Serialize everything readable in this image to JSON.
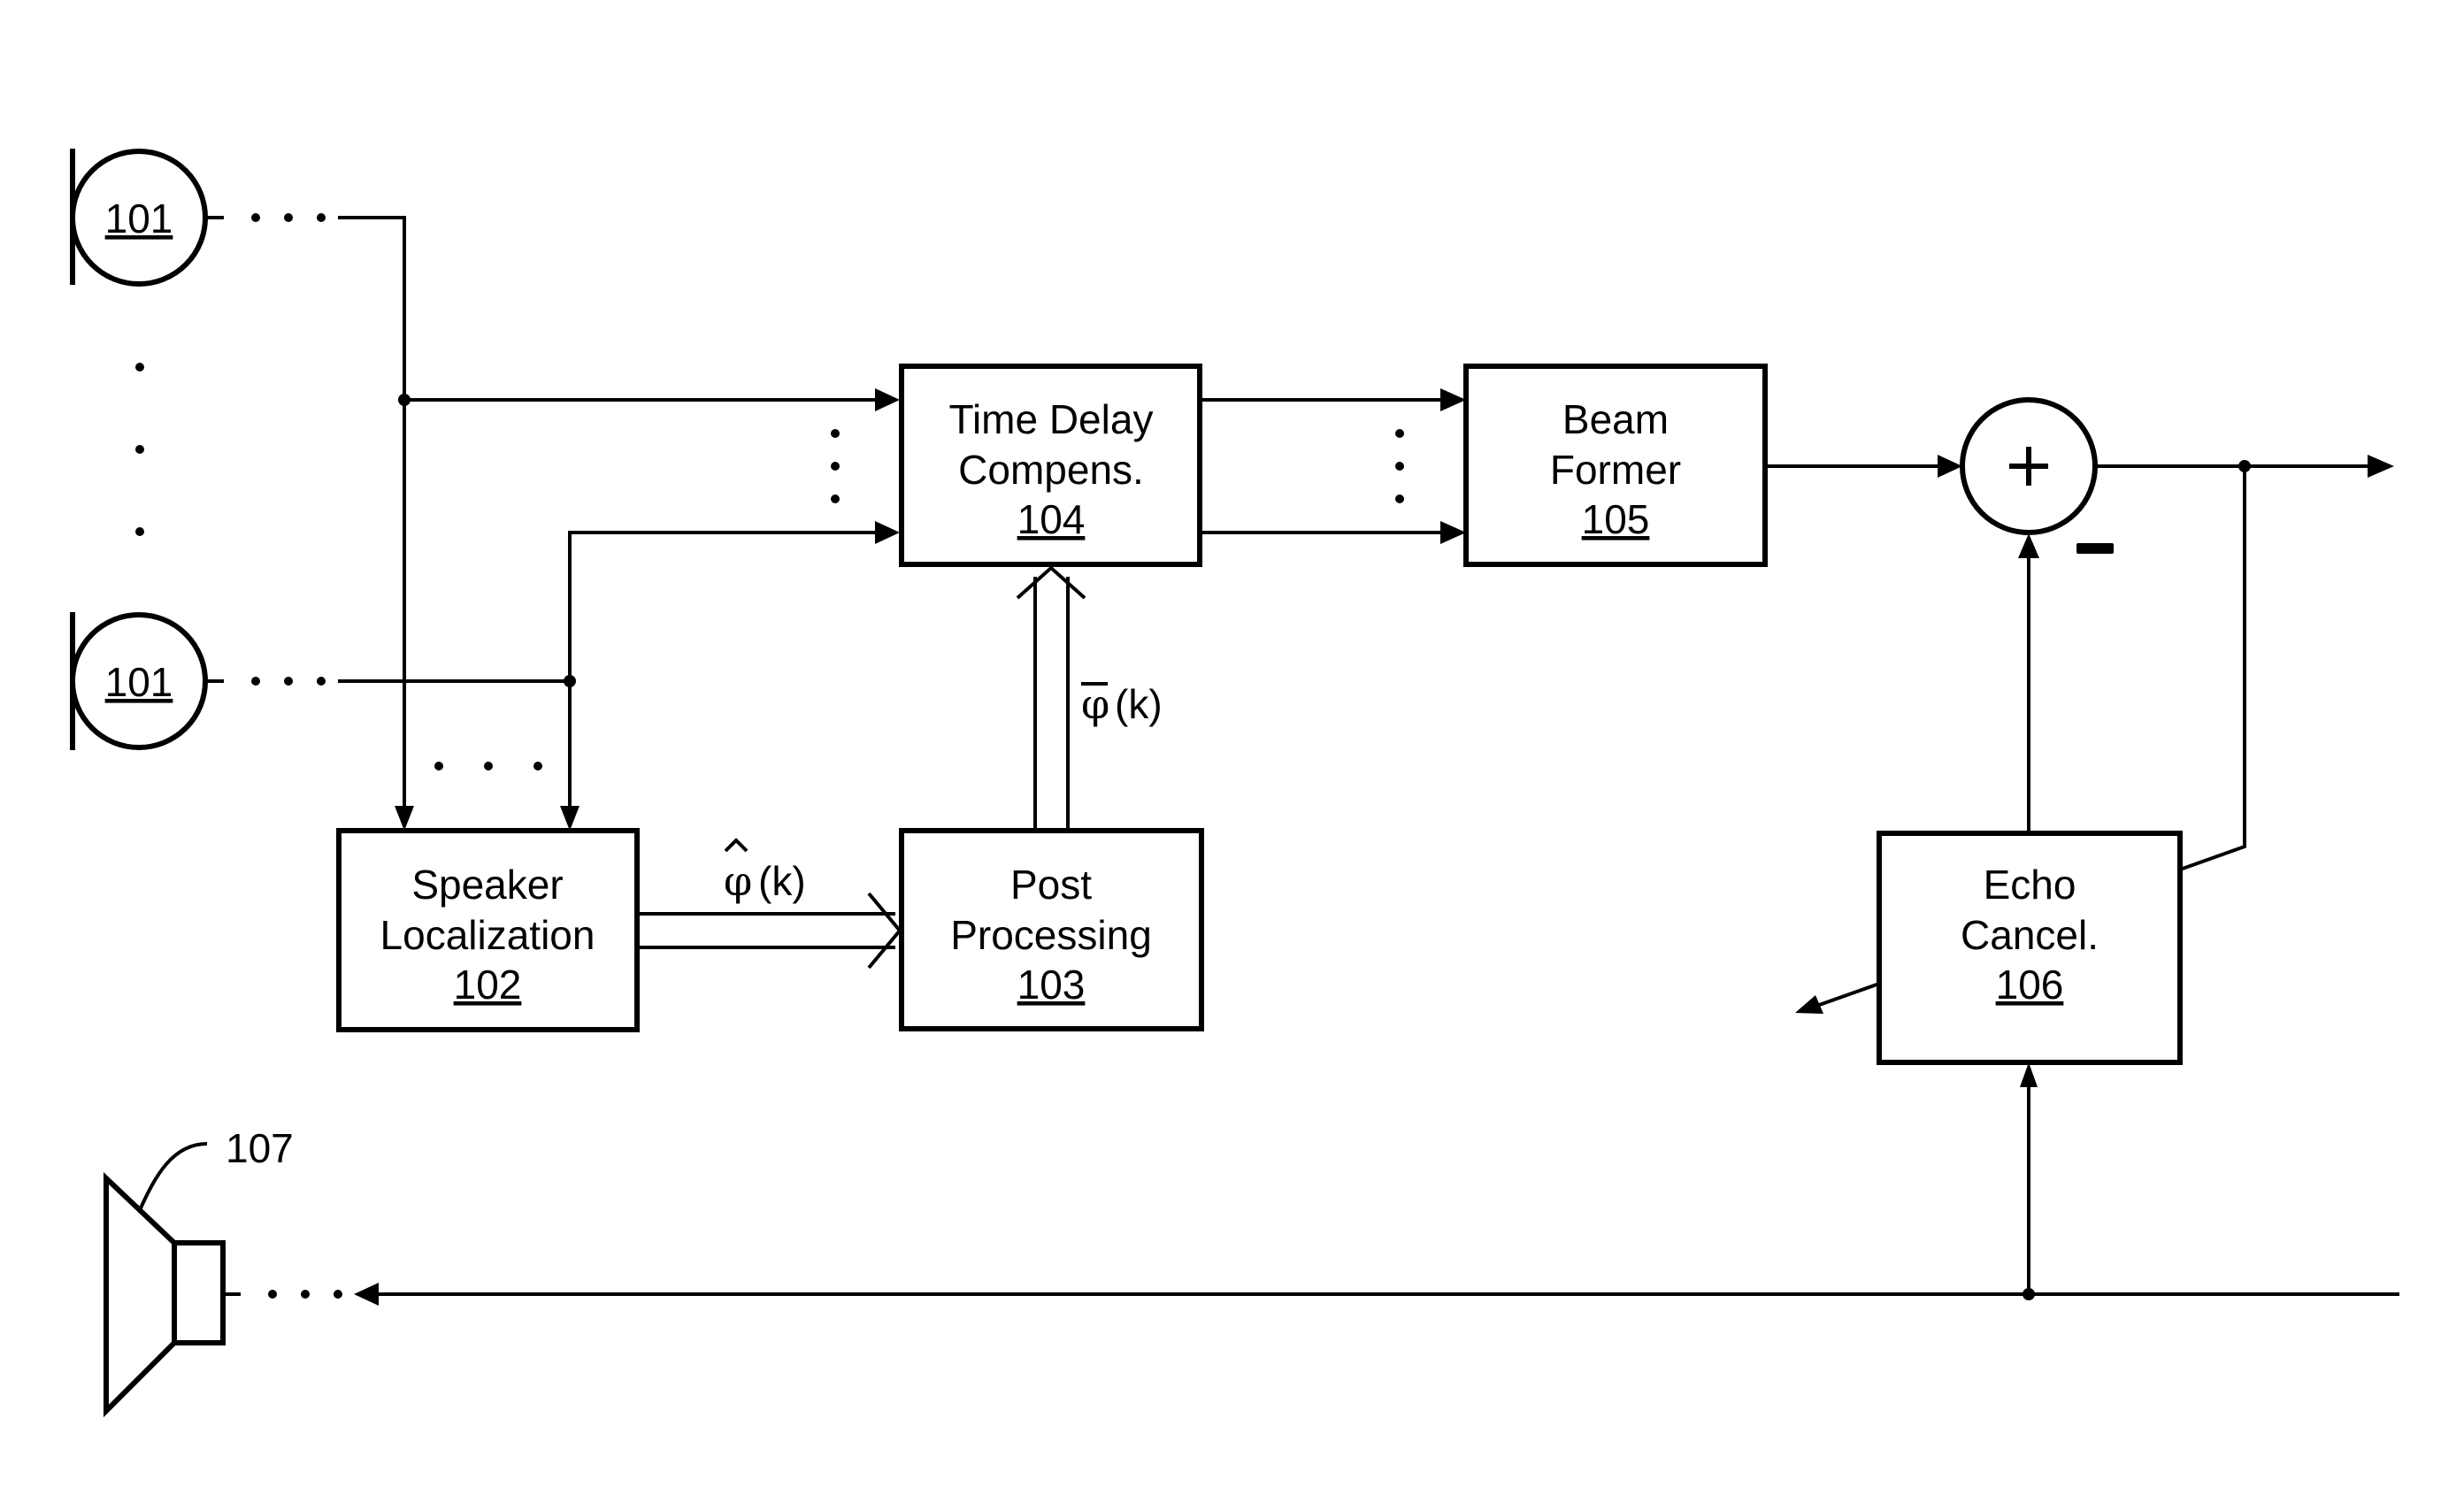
{
  "diagram": {
    "title": "",
    "microphones": [
      {
        "ref": "101",
        "name": "microphone-top"
      },
      {
        "ref": "101",
        "name": "microphone-bottom"
      }
    ],
    "blocks": {
      "speaker_localization": {
        "line1": "Speaker",
        "line2": "Localization",
        "ref": "102"
      },
      "post_processing": {
        "line1": "Post",
        "line2": "Processing",
        "ref": "103"
      },
      "time_delay": {
        "line1": "Time Delay",
        "line2": "Compens.",
        "ref": "104"
      },
      "beam_former": {
        "line1": "Beam",
        "line2": "Former",
        "ref": "105"
      },
      "echo_cancel": {
        "line1": "Echo",
        "line2": "Cancel.",
        "ref": "106"
      }
    },
    "summing_node": {
      "plus": "+",
      "minus_label": "−"
    },
    "loudspeaker": {
      "ref": "107"
    },
    "signals": {
      "phi_hat": {
        "symbol": "φ",
        "accent": "^",
        "arg": "(k)"
      },
      "phi_bar": {
        "symbol": "φ",
        "accent": "‾",
        "arg": "(k)"
      }
    },
    "ellipsis": "· · ·"
  }
}
